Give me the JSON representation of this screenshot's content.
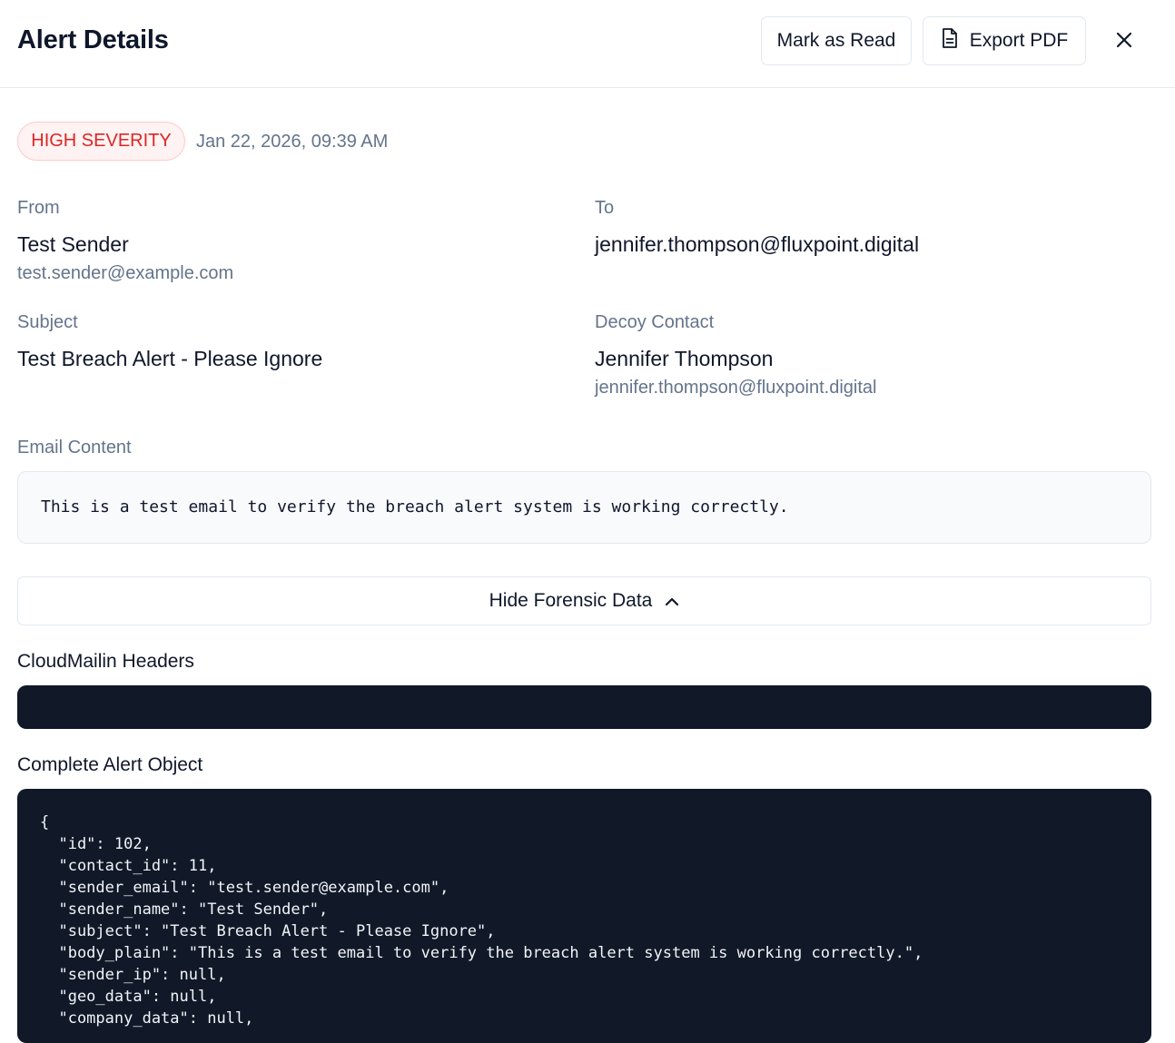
{
  "header": {
    "title": "Alert Details",
    "mark_read_label": "Mark as Read",
    "export_pdf_label": "Export PDF"
  },
  "meta": {
    "severity": "HIGH SEVERITY",
    "timestamp": "Jan 22, 2026, 09:39 AM"
  },
  "fields": {
    "from_label": "From",
    "from_name": "Test Sender",
    "from_email": "test.sender@example.com",
    "to_label": "To",
    "to_email": "jennifer.thompson@fluxpoint.digital",
    "subject_label": "Subject",
    "subject_value": "Test Breach Alert - Please Ignore",
    "decoy_label": "Decoy Contact",
    "decoy_name": "Jennifer Thompson",
    "decoy_email": "jennifer.thompson@fluxpoint.digital"
  },
  "email_content": {
    "label": "Email Content",
    "body": "This is a test email to verify the breach alert system is working correctly."
  },
  "forensic": {
    "toggle_label": "Hide Forensic Data",
    "headers_title": "CloudMailin Headers",
    "object_title": "Complete Alert Object",
    "json_lines": [
      "{",
      "  \"id\": 102,",
      "  \"contact_id\": 11,",
      "  \"sender_email\": \"test.sender@example.com\",",
      "  \"sender_name\": \"Test Sender\",",
      "  \"subject\": \"Test Breach Alert - Please Ignore\",",
      "  \"body_plain\": \"This is a test email to verify the breach alert system is working correctly.\",",
      "  \"sender_ip\": null,",
      "  \"geo_data\": null,",
      "  \"company_data\": null,"
    ]
  },
  "colors": {
    "severity_red": "#dc2626",
    "dark_panel": "#111827",
    "muted_text": "#64748b"
  }
}
